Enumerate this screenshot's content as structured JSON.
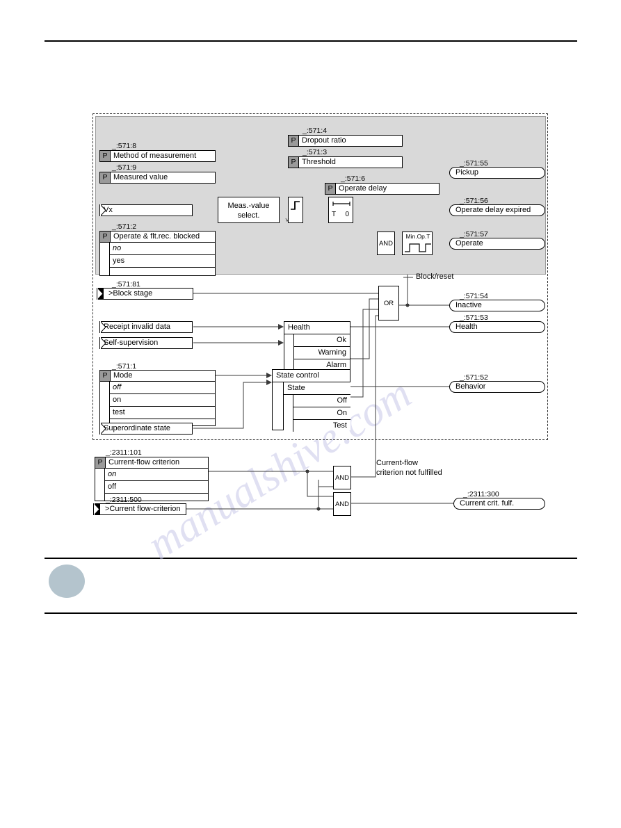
{
  "page": {
    "watermark": "manualshive.com"
  },
  "diagram": {
    "stage_frame_label": "",
    "top_group": {
      "params": [
        {
          "addr": "_:571:8",
          "label": "Method of measurement"
        },
        {
          "addr": "_:571:9",
          "label": "Measured value"
        },
        {
          "addr": "_:571:4",
          "label": "Dropout ratio"
        },
        {
          "addr": "_:571:3",
          "label": "Threshold"
        },
        {
          "addr": "_:571:6",
          "label": "Operate delay"
        }
      ],
      "blocked_param": {
        "addr": "_:571:2",
        "label": "Operate & flt.rec. blocked",
        "options": [
          "no",
          "yes"
        ],
        "selected": "no"
      },
      "input_flag": {
        "label": "Vx"
      },
      "meas_select_block": {
        "line1": "Meas.-value",
        "line2": "select."
      },
      "threshold_block": {
        "symbol": "<"
      },
      "timer_block": {
        "symbol": "T",
        "value": "0"
      },
      "and_gate": {
        "label": "AND"
      },
      "min_op_block": {
        "label": "Min.Op.T"
      },
      "outputs": [
        {
          "addr": "_:571:55",
          "label": "Pickup"
        },
        {
          "addr": "_:571:56",
          "label": "Operate delay expired"
        },
        {
          "addr": "_:571:57",
          "label": "Operate"
        }
      ]
    },
    "mid_group": {
      "block_stage": {
        "addr": "_:571:81",
        "label": ">Block stage"
      },
      "flags": [
        {
          "label": "Receipt invalid data"
        },
        {
          "label": "Self-supervision"
        },
        {
          "label": "Superordinate state"
        }
      ],
      "mode_param": {
        "addr": "_:571:1",
        "label": "Mode",
        "options": [
          "off",
          "on",
          "test"
        ],
        "selected": "off"
      },
      "health_box": {
        "title": "Health",
        "rows": [
          "Ok",
          "Warning",
          "Alarm"
        ]
      },
      "state_box": {
        "title": "State control",
        "sub": "State",
        "rows": [
          "Off",
          "On",
          "Test"
        ]
      },
      "or_gate": {
        "label": "OR"
      },
      "block_reset_note": "Block/reset",
      "outputs": [
        {
          "addr": "_:571:54",
          "label": "Inactive"
        },
        {
          "addr": "_:571:53",
          "label": "Health"
        },
        {
          "addr": "_:571:52",
          "label": "Behavior"
        }
      ]
    },
    "bottom_group": {
      "criterion_param": {
        "addr": "_:2311:101",
        "label": "Current-flow criterion",
        "options": [
          "on",
          "off"
        ],
        "selected": "on"
      },
      "criterion_input": {
        "addr": "_:2311:500",
        "label": ">Current flow-criterion"
      },
      "and_gate_top": {
        "label": "AND"
      },
      "and_gate_bottom": {
        "label": "AND"
      },
      "note": "Current-flow\ncriterion not fulfilled",
      "output": {
        "addr": "_:2311:300",
        "label": "Current crit. fulf."
      }
    }
  }
}
